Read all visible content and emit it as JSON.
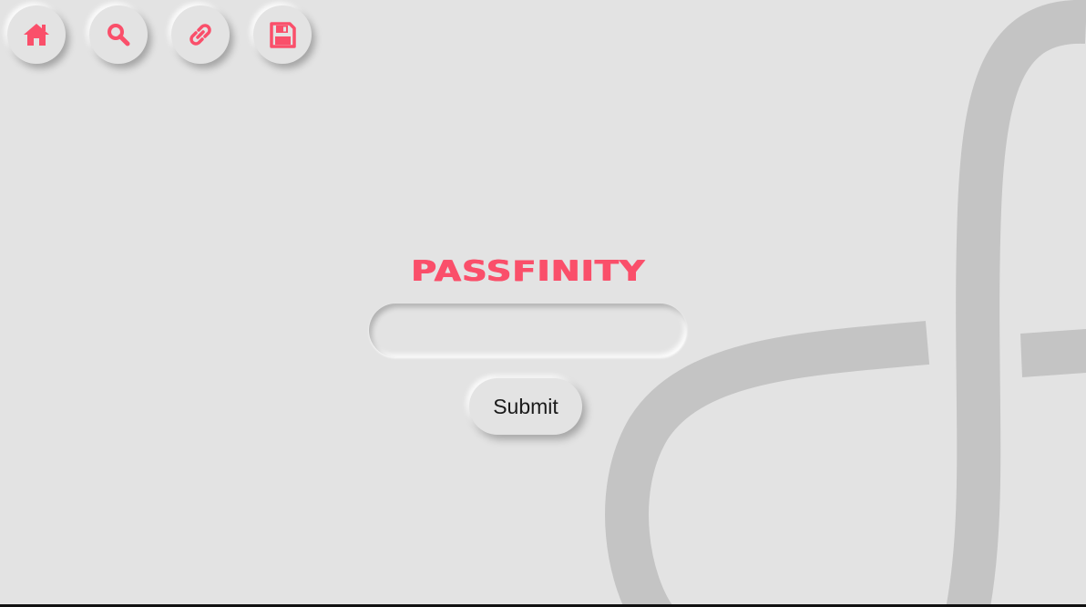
{
  "nav": {
    "items": [
      {
        "id": "home",
        "icon": "home-icon"
      },
      {
        "id": "search",
        "icon": "search-icon"
      },
      {
        "id": "link",
        "icon": "link-icon"
      },
      {
        "id": "save",
        "icon": "save-icon"
      }
    ]
  },
  "brand": {
    "title": "PASSFINITY"
  },
  "form": {
    "input_value": "",
    "input_placeholder": "",
    "submit_label": "Submit"
  },
  "colors": {
    "accent": "#fa4f6a",
    "background": "#e3e3e3",
    "swirl": "#c4c4c4",
    "button_text": "#1a1a1a"
  },
  "background": {
    "decoration": "infinity-swirl"
  }
}
